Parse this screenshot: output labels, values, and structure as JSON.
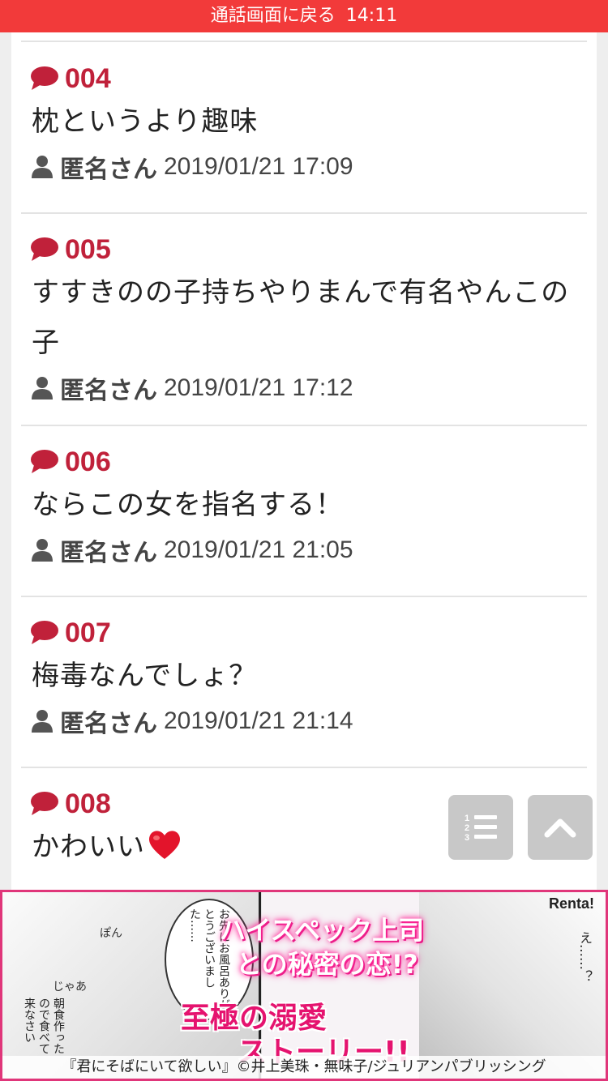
{
  "call_bar": {
    "label": "通話画面に戻る",
    "time": "14:11"
  },
  "posts": [
    {
      "number": "004",
      "body": "枕というより趣味",
      "author": "匿名さん",
      "date": "2019/01/21 17:09"
    },
    {
      "number": "005",
      "body": "すすきのの子持ちやりまんで有名やんこの子",
      "author": "匿名さん",
      "date": "2019/01/21 17:12"
    },
    {
      "number": "006",
      "body": "ならこの女を指名する！",
      "author": "匿名さん",
      "date": "2019/01/21 21:05"
    },
    {
      "number": "007",
      "body": "梅毒なんでしょ？",
      "author": "匿名さん",
      "date": "2019/01/21 21:14"
    },
    {
      "number": "008",
      "body": "かわいい"
    }
  ],
  "floating_buttons": {
    "list_icon": "numbered-list-icon",
    "top_icon": "chevron-up-icon"
  },
  "banner": {
    "brand": "Renta!",
    "headline_1": "ハイスペック上司",
    "headline_2": "との秘密の恋!?",
    "headline_3": "至極の溺愛",
    "headline_4": "ストーリー!!",
    "speech_1": "お先にお風呂ありがとうございました……",
    "speech_2": "朝食作ったので食べて来なさい",
    "sfx_1": "ぽん",
    "sfx_2": "じゃあ",
    "speech_3": "え……？",
    "credit": "『君にそばにいて欲しい』©井上美珠・無味子/ジュリアンパブリッシング"
  },
  "colors": {
    "call_bar": "#f23a3a",
    "accent": "#c0213a",
    "banner_pink": "#e5136f"
  }
}
